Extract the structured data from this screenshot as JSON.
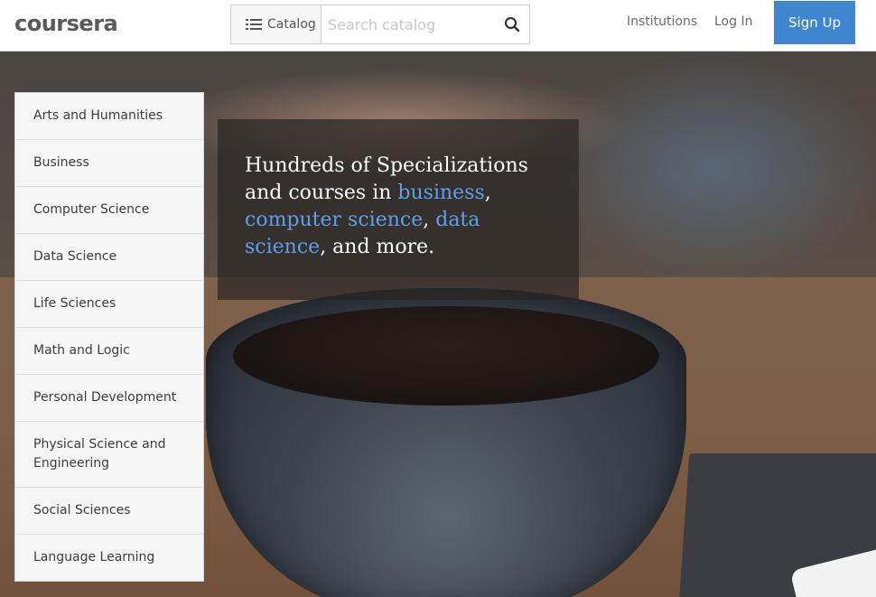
{
  "header": {
    "logo_text": "coursera",
    "catalog_label": "Catalog",
    "search_placeholder": "Search catalog",
    "nav": {
      "institutions": "Institutions",
      "login": "Log In",
      "signup": "Sign Up"
    }
  },
  "categories": [
    "Arts and Humanities",
    "Business",
    "Computer Science",
    "Data Science",
    "Life Sciences",
    "Math and Logic",
    "Personal Development",
    "Physical Science and Engineering",
    "Social Sciences",
    "Language Learning"
  ],
  "headline": {
    "part1": "Hundreds of Specializations and courses in ",
    "link1": "business",
    "part2": ", ",
    "link2": "computer science",
    "part3": ", ",
    "link3": "data science",
    "part4": ", and more."
  },
  "colors": {
    "brand_blue": "#3f86d0",
    "highlight_blue": "#5da0ea"
  },
  "icons": {
    "catalog": "list-icon",
    "search": "search-icon"
  }
}
